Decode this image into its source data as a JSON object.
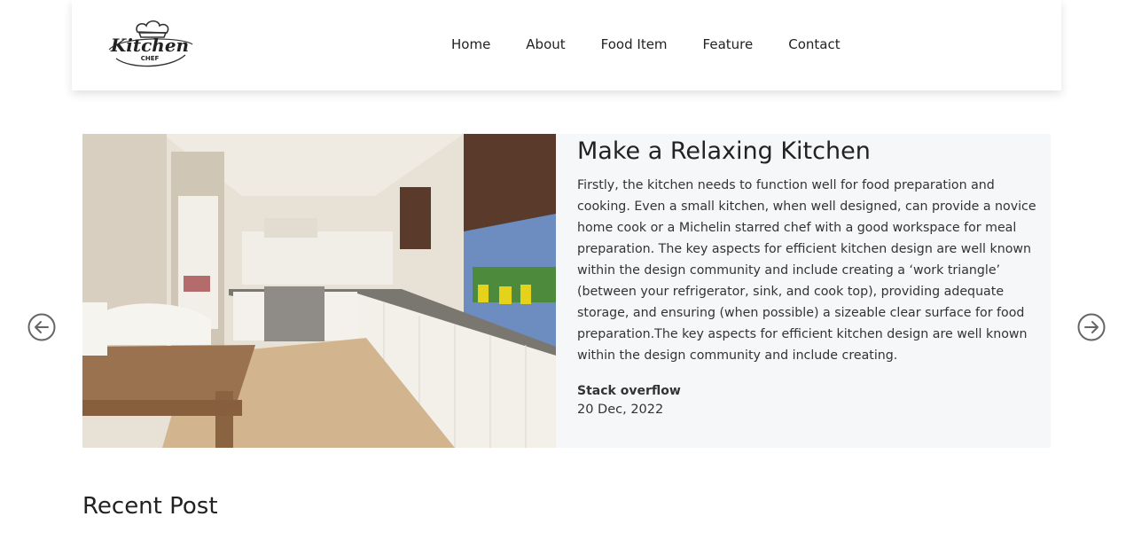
{
  "header": {
    "logo": {
      "text_main": "Kitchen",
      "text_sub": "CHEF"
    },
    "nav": [
      "Home",
      "About",
      "Food Item",
      "Feature",
      "Contact"
    ]
  },
  "slider": {
    "title": "Make a Relaxing Kitchen",
    "body": "Firstly, the kitchen needs to function well for food preparation and cooking. Even a small kitchen, when well designed, can provide a novice home cook or a Michelin starred chef with a good workspace for meal preparation. The key aspects for efficient kitchen design are well known within the design community and include creating a ‘work triangle’ (between your refrigerator, sink, and cook top), providing adequate storage, and ensuring (when possible) a sizeable clear surface for food preparation.The key aspects for efficient kitchen design are well known within the design community and include creating.",
    "author": "Stack overflow",
    "date": "20 Dec, 2022",
    "prev_icon": "arrow-left-circle-icon",
    "next_icon": "arrow-right-circle-icon"
  },
  "recent": {
    "title": "Recent Post"
  },
  "colors": {
    "panel_bg": "#f6f7f9",
    "text": "#222222",
    "arrow": "#666666"
  }
}
